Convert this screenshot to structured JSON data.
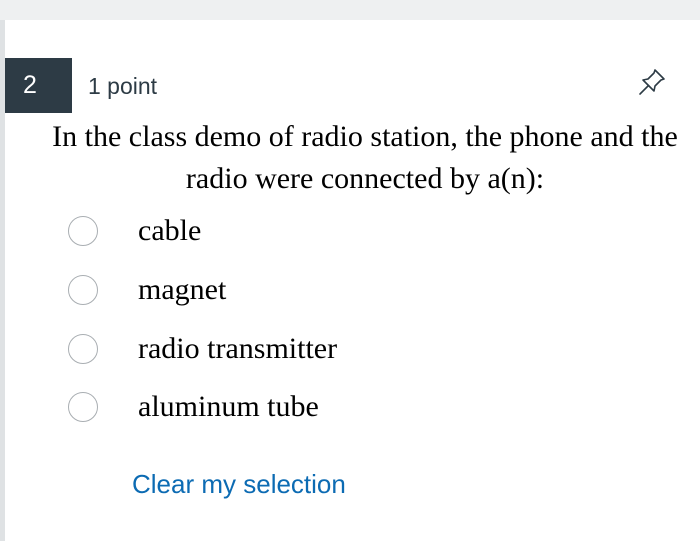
{
  "question": {
    "number": "2",
    "points": "1 point",
    "text": "In the class demo of radio station, the phone and the radio were connected by a(n):",
    "pin_icon": "pin-icon",
    "options": [
      {
        "label": "cable",
        "selected": false
      },
      {
        "label": "magnet",
        "selected": false
      },
      {
        "label": "radio transmitter",
        "selected": false
      },
      {
        "label": "aluminum tube",
        "selected": false
      }
    ],
    "clear_label": "Clear my selection"
  },
  "colors": {
    "number_badge_bg": "#2d3b45",
    "link": "#0c6bb3",
    "radio_border": "#a9aeb2"
  }
}
